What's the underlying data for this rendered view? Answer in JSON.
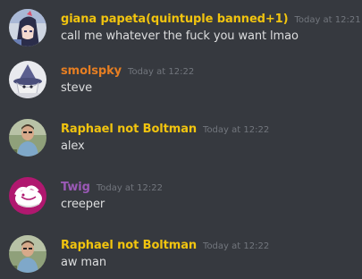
{
  "colors": {
    "background": "#36393f",
    "timestamp": "#72767d",
    "message_text": "#dcddde"
  },
  "messages": [
    {
      "author": "giana papeta(quintuple banned+1)",
      "author_color": "#f1c40f",
      "timestamp": "Today at 12:21",
      "text": "call me whatever the fuck you want lmao",
      "avatar_icon": "anime-girl-avatar-icon"
    },
    {
      "author": "smolspky",
      "author_color": "#e67e22",
      "timestamp": "Today at 12:22",
      "text": "steve",
      "avatar_icon": "wizard-hat-avatar-icon"
    },
    {
      "author": "Raphael not Boltman",
      "author_color": "#f1c40f",
      "timestamp": "Today at 12:22",
      "text": "alex",
      "avatar_icon": "person-photo-avatar-icon"
    },
    {
      "author": "Twig",
      "author_color": "#9b59b6",
      "timestamp": "Today at 12:22",
      "text": "creeper",
      "avatar_icon": "cartoon-creature-avatar-icon"
    },
    {
      "author": "Raphael not Boltman",
      "author_color": "#f1c40f",
      "timestamp": "Today at 12:22",
      "text": "aw man",
      "avatar_icon": "person-photo-avatar-icon"
    }
  ]
}
